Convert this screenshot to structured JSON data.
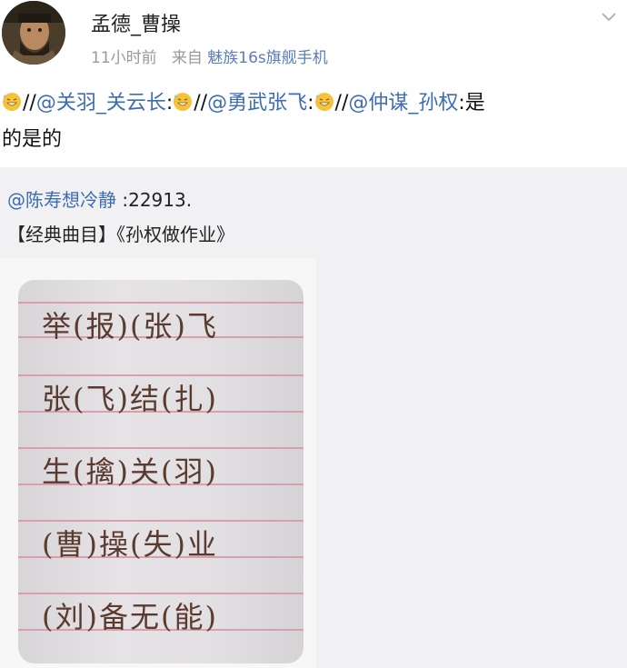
{
  "header": {
    "username": "孟德_曹操",
    "time": "11小时前",
    "source_prefix": "来自",
    "device": "魅族16s旗舰手机"
  },
  "post": {
    "seg1": "//",
    "mention1": "@关羽_关云长",
    "seg2": ":",
    "seg3": "//",
    "mention2": "@勇武张飞",
    "seg4": ":",
    "seg5": "//",
    "mention3": "@仲谋_孙权",
    "seg6": ":是",
    "line2": "的是的",
    "emoji_icon": "grinning-sweat-emoji"
  },
  "repost": {
    "mention": "@陈寿想冷静",
    "text": " :22913.",
    "line2": "【经典曲目】《孙权做作业》"
  },
  "notebook": {
    "rows": [
      "举(报)(张)飞",
      "张(飞)结(扎)",
      "生(擒)关(羽)",
      "(曹)操(失)业",
      "(刘)备无(能)"
    ]
  },
  "colors": {
    "mention": "#3d6cb0",
    "meta": "#999999",
    "repost_bg": "#f1f1f3",
    "ink": "#5a3b2e",
    "rule": "#d7a0ae"
  }
}
